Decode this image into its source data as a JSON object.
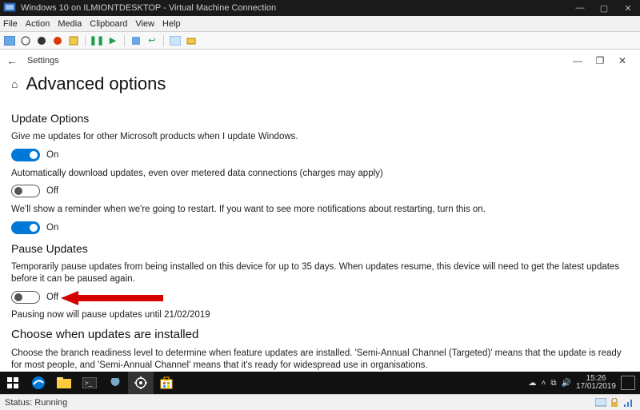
{
  "vm": {
    "title": "Windows 10 on ILMIONTDESKTOP - Virtual Machine Connection",
    "menu": [
      "File",
      "Action",
      "Media",
      "Clipboard",
      "View",
      "Help"
    ],
    "status": "Status: Running"
  },
  "colors": {
    "accent": "#0078d7",
    "arrow": "#d40000"
  },
  "settings": {
    "app_label": "Settings",
    "page_title": "Advanced options",
    "sections": {
      "update_options": {
        "heading": "Update Options",
        "opt1": {
          "desc": "Give me updates for other Microsoft products when I update Windows.",
          "state": "On"
        },
        "opt2": {
          "desc": "Automatically download updates, even over metered data connections (charges may apply)",
          "state": "Off"
        },
        "opt3": {
          "desc": "We'll show a reminder when we're going to restart. If you want to see more notifications about restarting, turn this on.",
          "state": "On"
        }
      },
      "pause": {
        "heading": "Pause Updates",
        "desc": "Temporarily pause updates from being installed on this device for up to 35 days. When updates resume, this device will need to get the latest updates before it can be paused again.",
        "state": "Off",
        "note": "Pausing now will pause updates until 21/02/2019"
      },
      "choose": {
        "heading": "Choose when updates are installed",
        "desc": "Choose the branch readiness level to determine when feature updates are installed. 'Semi-Annual Channel (Targeted)' means that the update is ready for most people, and 'Semi-Annual Channel' means that it's ready for widespread use in organisations."
      }
    }
  },
  "taskbar": {
    "time": "15:26",
    "date": "17/01/2019"
  }
}
